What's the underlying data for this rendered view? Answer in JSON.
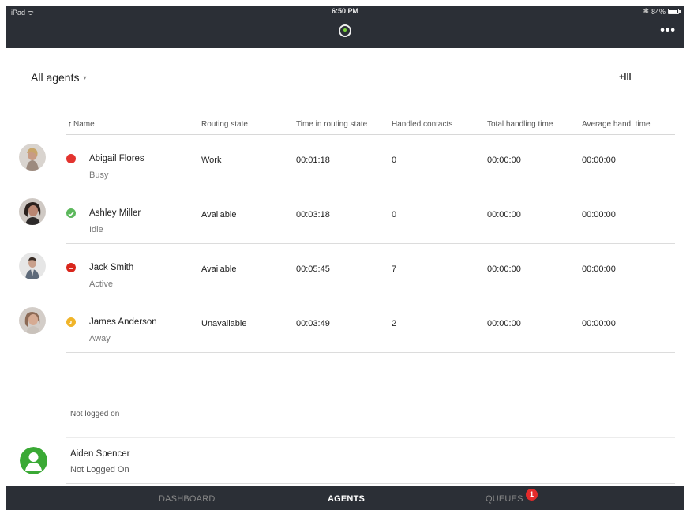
{
  "status_bar": {
    "device": "iPad ᯤ",
    "time": "6:50 PM",
    "bluetooth": "✱",
    "battery": "84%"
  },
  "header": {
    "logo_icon": "app-logo-icon",
    "more_label": "•••"
  },
  "filter": {
    "label": "All agents",
    "caret": "▾",
    "columns_label": "+lll"
  },
  "table": {
    "sort_arrow": "↑",
    "columns": [
      "Name",
      "Routing state",
      "Time in routing state",
      "Handled contacts",
      "Total handling time",
      "Average hand. time"
    ],
    "rows": [
      {
        "name": "Abigail Flores",
        "status": "Busy",
        "routing_state": "Work",
        "time_in_state": "00:01:18",
        "handled": "0",
        "total_time": "00:00:00",
        "avg_time": "00:00:00",
        "dot_color": "#e3342f",
        "dot_type": "busy"
      },
      {
        "name": "Ashley Miller",
        "status": "Idle",
        "routing_state": "Available",
        "time_in_state": "00:03:18",
        "handled": "0",
        "total_time": "00:00:00",
        "avg_time": "00:00:00",
        "dot_color": "#5cb85c",
        "dot_type": "check"
      },
      {
        "name": "Jack Smith",
        "status": "Active",
        "routing_state": "Available",
        "time_in_state": "00:05:45",
        "handled": "7",
        "total_time": "00:00:00",
        "avg_time": "00:00:00",
        "dot_color": "#d9261c",
        "dot_type": "dnd"
      },
      {
        "name": "James Anderson",
        "status": "Away",
        "routing_state": "Unavailable",
        "time_in_state": "00:03:49",
        "handled": "2",
        "total_time": "00:00:00",
        "avg_time": "00:00:00",
        "dot_color": "#f0b429",
        "dot_type": "away"
      }
    ]
  },
  "not_logged": {
    "section_label": "Not logged on",
    "agent_name": "Aiden Spencer",
    "agent_status": "Not Logged On"
  },
  "tabbar": {
    "tabs": [
      "DASHBOARD",
      "AGENTS",
      "QUEUES"
    ],
    "active": "AGENTS",
    "queues_badge": "1"
  },
  "colors": {
    "header_bg": "#2b2f36",
    "badge": "#e42b2b"
  }
}
